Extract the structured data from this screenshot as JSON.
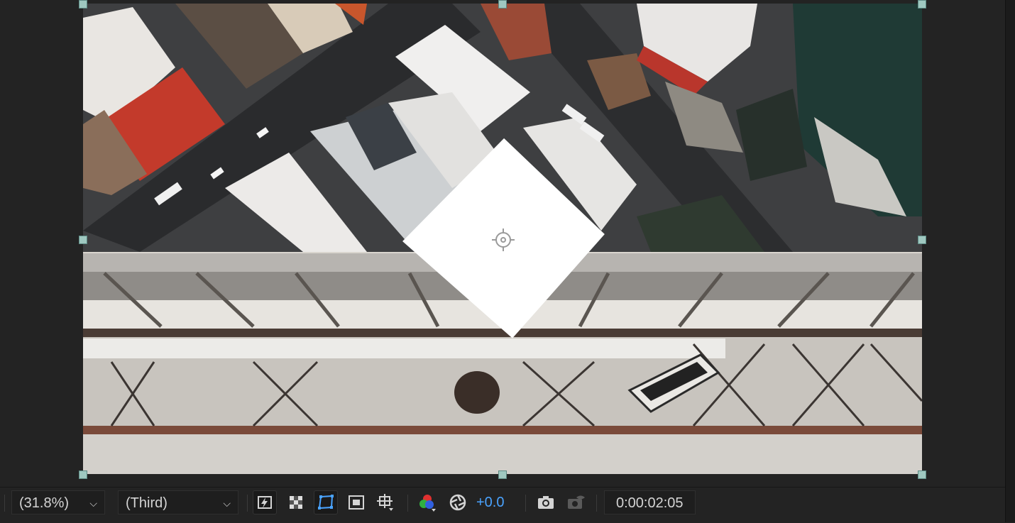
{
  "viewer": {
    "zoom_label": "(31.8%)",
    "resolution_label": "(Third)",
    "exposure_label": "+0.0",
    "timecode": "0:00:02:05"
  },
  "toolbar": {
    "icons": [
      "fast-previews-icon",
      "transparency-grid-icon",
      "mask-path-visibility-icon",
      "region-of-interest-icon",
      "grid-guides-icon",
      "show-channel-icon",
      "reset-exposure-icon",
      "snapshot-camera-icon",
      "show-snapshot-icon"
    ]
  },
  "colors": {
    "panel_bg": "#232323",
    "handle": "#9fc8c0",
    "exposure_blue": "#4aa3ff",
    "text": "#d4d4d4"
  }
}
